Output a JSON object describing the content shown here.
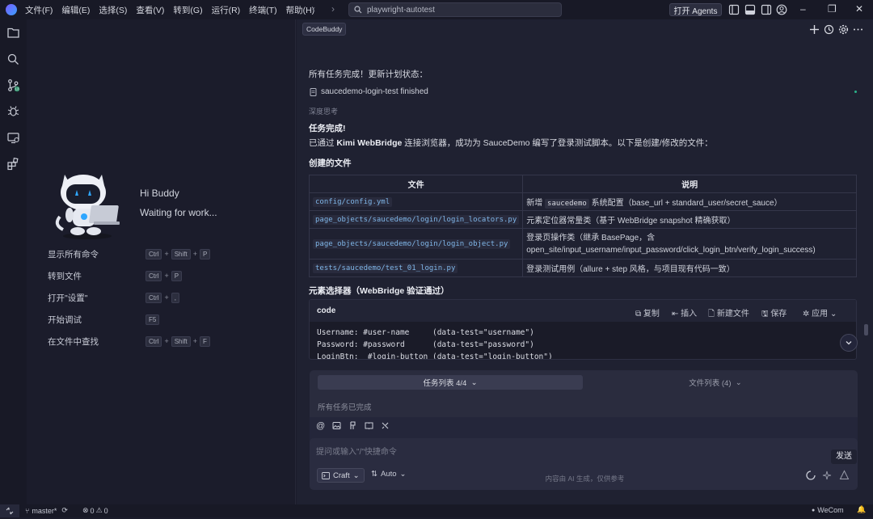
{
  "menu": [
    "文件(F)",
    "编辑(E)",
    "选择(S)",
    "查看(V)",
    "转到(G)",
    "运行(R)",
    "终端(T)",
    "帮助(H)"
  ],
  "search": {
    "value": "playwright-autotest"
  },
  "agents_button": "打开 Agents",
  "welcome": {
    "greeting": "Hi Buddy",
    "status": "Waiting for work...",
    "shortcuts": [
      {
        "label": "显示所有命令",
        "keys": [
          "Ctrl",
          "Shift",
          "P"
        ]
      },
      {
        "label": "转到文件",
        "keys": [
          "Ctrl",
          "P"
        ]
      },
      {
        "label": "打开\"设置\"",
        "keys": [
          "Ctrl",
          ","
        ]
      },
      {
        "label": "开始调试",
        "keys": [
          "F5"
        ]
      },
      {
        "label": "在文件中查找",
        "keys": [
          "Ctrl",
          "Shift",
          "F"
        ]
      }
    ]
  },
  "chat": {
    "tab": "CodeBuddy",
    "plan_update": "所有任务完成！更新计划状态：",
    "plan_item": "saucedemo-login-test finished",
    "deep_thinking": "深度思考",
    "done_heading": "任务完成!",
    "summary_prefix": "已通过 ",
    "summary_bold": "Kimi WebBridge",
    "summary_suffix": " 连接浏览器，成功为 SauceDemo 编写了登录测试脚本。以下是创建/修改的文件：",
    "files_heading": "创建的文件",
    "table_headers": [
      "文件",
      "说明"
    ],
    "table_rows": [
      {
        "file": "config/config.yml",
        "desc_pre": "新增 ",
        "desc_code": "saucedemo",
        "desc_post": " 系统配置（base_url + standard_user/secret_sauce）"
      },
      {
        "file": "page_objects/saucedemo/login/login_locators.py",
        "desc_pre": "元素定位器常量类（基于 WebBridge snapshot 精确获取）",
        "desc_code": "",
        "desc_post": ""
      },
      {
        "file": "page_objects/saucedemo/login/login_object.py",
        "desc_pre": "登录页操作类（继承 BasePage，含",
        "desc_code": "",
        "desc_post": "open_site/input_username/input_password/click_login_btn/verify_login_success)"
      },
      {
        "file": "tests/saucedemo/test_01_login.py",
        "desc_pre": "登录测试用例（allure + step 风格，与项目现有代码一致）",
        "desc_code": "",
        "desc_post": ""
      }
    ],
    "selector_heading": "元素选择器（WebBridge 验证通过）",
    "code": {
      "title": "code",
      "actions": [
        "复制",
        "插入",
        "新建文件",
        "保存",
        "应用"
      ],
      "lines": [
        "Username: #user-name     (data-test=\"username\")",
        "Password: #password      (data-test=\"password\")",
        "LoginBtn:  #login-button (data-test=\"login-button\")"
      ]
    }
  },
  "tasks": {
    "tab_tasks": "任务列表 4/4",
    "tab_files": "文件列表 (4)",
    "status": "所有任务已完成"
  },
  "input": {
    "placeholder": "提问或输入\"/\"快捷命令",
    "send": "发送",
    "mode": "Craft",
    "model": "Auto",
    "disclaimer": "内容由 AI 生成，仅供参考"
  },
  "status_bar": {
    "branch": "master*",
    "errors": "0",
    "warnings": "0",
    "wecom": "WeCom"
  },
  "colors": {
    "accent": "#7fb6e8",
    "background": "#1f2131"
  }
}
